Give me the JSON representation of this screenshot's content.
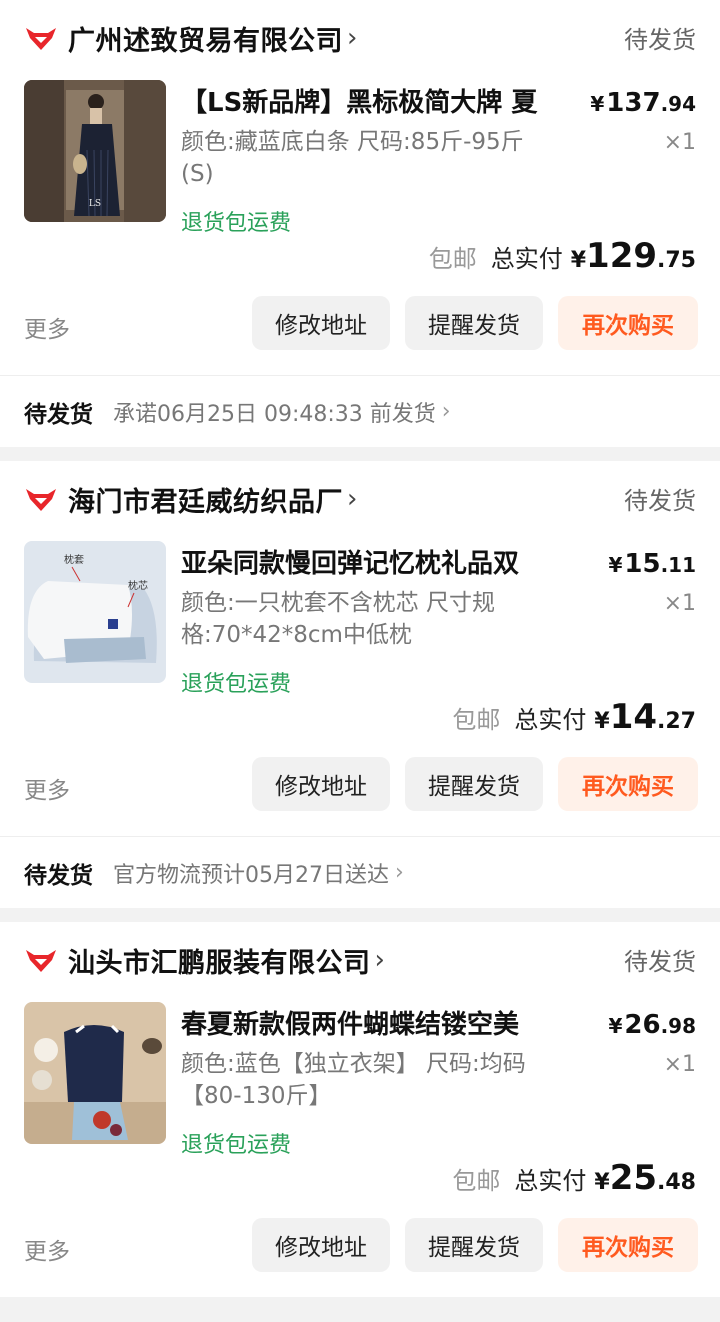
{
  "colors": {
    "accent": "#ff5a1f",
    "green": "#2aa15a",
    "shop_logo": "#e8262b"
  },
  "orders": [
    {
      "shop": "广州述致贸易有限公司",
      "status": "待发货",
      "title": "【LS新品牌】黑标极简大牌 夏",
      "spec": "颜色:藏蓝底白条 尺码:85斤-95斤(S)",
      "refund": "退货包运费",
      "price_yen": "¥",
      "price_int": "137",
      "price_dec": ".94",
      "qty": "×1",
      "free_ship": "包邮",
      "total_label": "总实付",
      "total_yen": "¥",
      "total_int": "129",
      "total_dec": ".75",
      "more": "更多",
      "btn_addr": "修改地址",
      "btn_remind": "提醒发货",
      "btn_rebuy": "再次购买",
      "ship_label": "待发货",
      "ship_info": "承诺06月25日 09:48:33 前发货"
    },
    {
      "shop": "海门市君廷威纺织品厂",
      "status": "待发货",
      "title": "亚朵同款慢回弹记忆枕礼品双",
      "spec": "颜色:一只枕套不含枕芯 尺寸规格:70*42*8cm中低枕",
      "refund": "退货包运费",
      "price_yen": "¥",
      "price_int": "15",
      "price_dec": ".11",
      "qty": "×1",
      "free_ship": "包邮",
      "total_label": "总实付",
      "total_yen": "¥",
      "total_int": "14",
      "total_dec": ".27",
      "more": "更多",
      "btn_addr": "修改地址",
      "btn_remind": "提醒发货",
      "btn_rebuy": "再次购买",
      "ship_label": "待发货",
      "ship_info": "官方物流预计05月27日送达",
      "thumb_label_1": "枕套",
      "thumb_label_2": "枕芯"
    },
    {
      "shop": "汕头市汇鹏服装有限公司",
      "status": "待发货",
      "title": "春夏新款假两件蝴蝶结镂空美",
      "spec": "颜色:蓝色【独立衣架】 尺码:均码【80-130斤】",
      "refund": "退货包运费",
      "price_yen": "¥",
      "price_int": "26",
      "price_dec": ".98",
      "qty": "×1",
      "free_ship": "包邮",
      "total_label": "总实付",
      "total_yen": "¥",
      "total_int": "25",
      "total_dec": ".48",
      "more": "更多",
      "btn_addr": "修改地址",
      "btn_remind": "提醒发货",
      "btn_rebuy": "再次购买"
    }
  ]
}
